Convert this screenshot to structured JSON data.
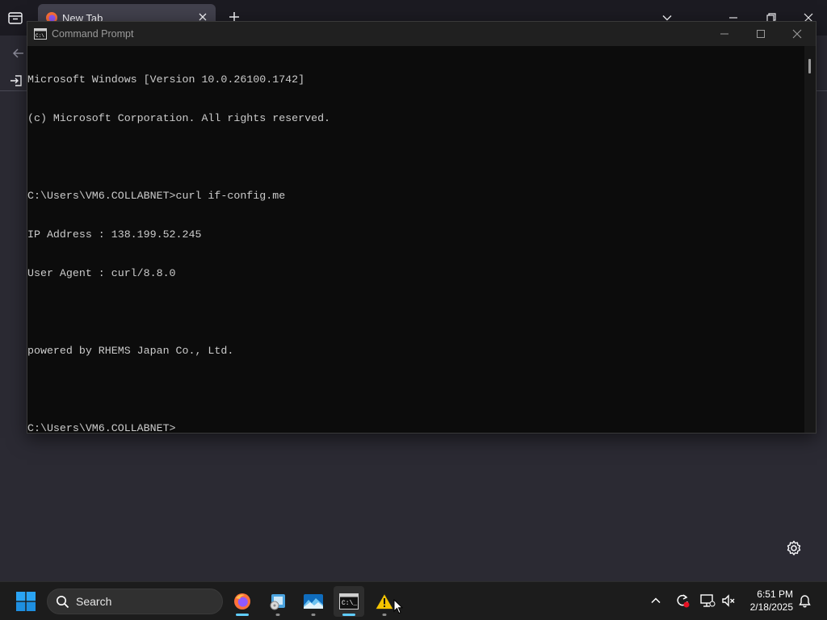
{
  "browser": {
    "tab_title": "New Tab"
  },
  "cmd": {
    "title": "Command Prompt",
    "lines": [
      "Microsoft Windows [Version 10.0.26100.1742]",
      "(c) Microsoft Corporation. All rights reserved.",
      "",
      "C:\\Users\\VM6.COLLABNET>curl if-config.me",
      "IP Address : 138.199.52.245",
      "User Agent : curl/8.8.0",
      "",
      "powered by RHEMS Japan Co., Ltd.",
      "",
      "C:\\Users\\VM6.COLLABNET>"
    ]
  },
  "taskbar": {
    "search_label": "Search",
    "apps": [
      {
        "name": "firefox",
        "icon": "firefox-icon",
        "state": "running"
      },
      {
        "name": "setup",
        "icon": "installer-icon",
        "state": "open"
      },
      {
        "name": "wallpaper",
        "icon": "landscape-icon",
        "state": "open"
      },
      {
        "name": "command-prompt",
        "icon": "terminal-icon",
        "state": "active"
      },
      {
        "name": "warning-app",
        "icon": "warning-icon",
        "state": "open"
      }
    ],
    "time": "6:51 PM",
    "date": "2/18/2025"
  },
  "colors": {
    "cmd_bg": "#0c0c0c",
    "cmd_text": "#cccccc",
    "taskbar_bg": "#1c1c1c",
    "accent": "#60cdff"
  }
}
